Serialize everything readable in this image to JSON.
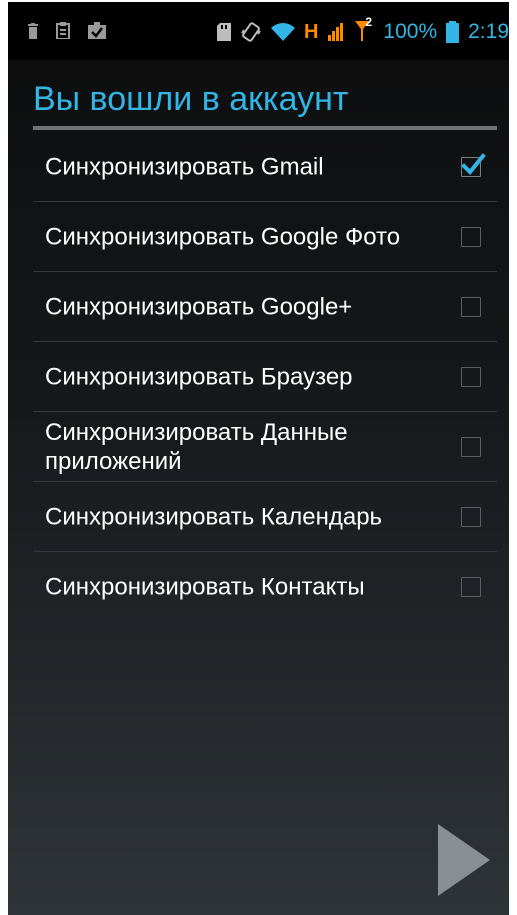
{
  "status_bar": {
    "network": "H",
    "sim_badge": "2",
    "battery_text": "100%",
    "time": "2:19"
  },
  "title": "Вы вошли в аккаунт",
  "sync_items": [
    {
      "label": "Синхронизировать Gmail",
      "checked": true
    },
    {
      "label": "Синхронизировать Google Фото",
      "checked": false
    },
    {
      "label": "Синхронизировать Google+",
      "checked": false
    },
    {
      "label": "Синхронизировать Браузер",
      "checked": false
    },
    {
      "label": "Синхронизировать Данные приложений",
      "checked": false
    },
    {
      "label": "Синхронизировать Календарь",
      "checked": false
    },
    {
      "label": "Синхронизировать Контакты",
      "checked": false
    }
  ],
  "icons": {
    "left": [
      "trash-icon",
      "clipboard-icon",
      "task-check-icon"
    ],
    "right": [
      "sd-card-icon",
      "vibrate-icon",
      "wifi-icon",
      "signal-icon",
      "no-sim-icon",
      "battery-icon"
    ],
    "next": "next-arrow-icon"
  },
  "colors": {
    "accent": "#33b5e5",
    "network": "#ff8a00"
  }
}
